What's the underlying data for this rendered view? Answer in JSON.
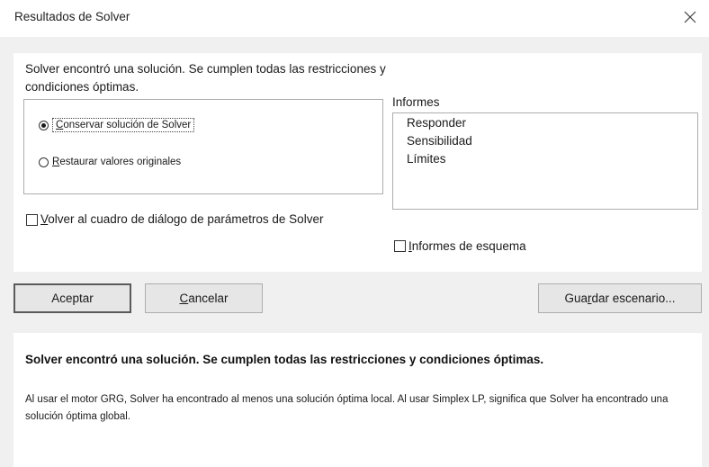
{
  "window": {
    "title": "Resultados de Solver",
    "close_icon": "close-icon"
  },
  "main": {
    "message": "Solver encontró una solución. Se cumplen todas las restricciones y condiciones óptimas.",
    "radio_options": [
      {
        "label_prefix": "",
        "label_key": "C",
        "label_rest": "onservar solución de Solver",
        "checked": true
      },
      {
        "label_prefix": "",
        "label_key": "R",
        "label_rest": "estaurar valores originales",
        "checked": false
      }
    ],
    "informes": {
      "label": "Informes",
      "items": [
        "Responder",
        "Sensibilidad",
        "Límites"
      ]
    },
    "checkboxes": {
      "volver": {
        "label_key": "V",
        "label_rest": "olver al cuadro de diálogo de parámetros de Solver",
        "checked": false
      },
      "esquema": {
        "label_key": "I",
        "label_rest": "nformes de esquema",
        "checked": false
      }
    }
  },
  "buttons": {
    "aceptar": "Aceptar",
    "cancelar_key": "C",
    "cancelar_rest": "ancelar",
    "guardar_pre": "Gua",
    "guardar_key": "r",
    "guardar_rest": "dar escenario..."
  },
  "footer": {
    "title": "Solver encontró una solución. Se cumplen todas las restricciones y condiciones óptimas.",
    "description": "Al usar el motor GRG, Solver ha encontrado al menos una solución óptima local. Al usar Simplex LP, significa que Solver ha encontrado una solución óptima global."
  },
  "colors": {
    "background": "#f0f0f0",
    "panel": "#ffffff",
    "border": "#adadad",
    "button": "#e6e6e6"
  }
}
